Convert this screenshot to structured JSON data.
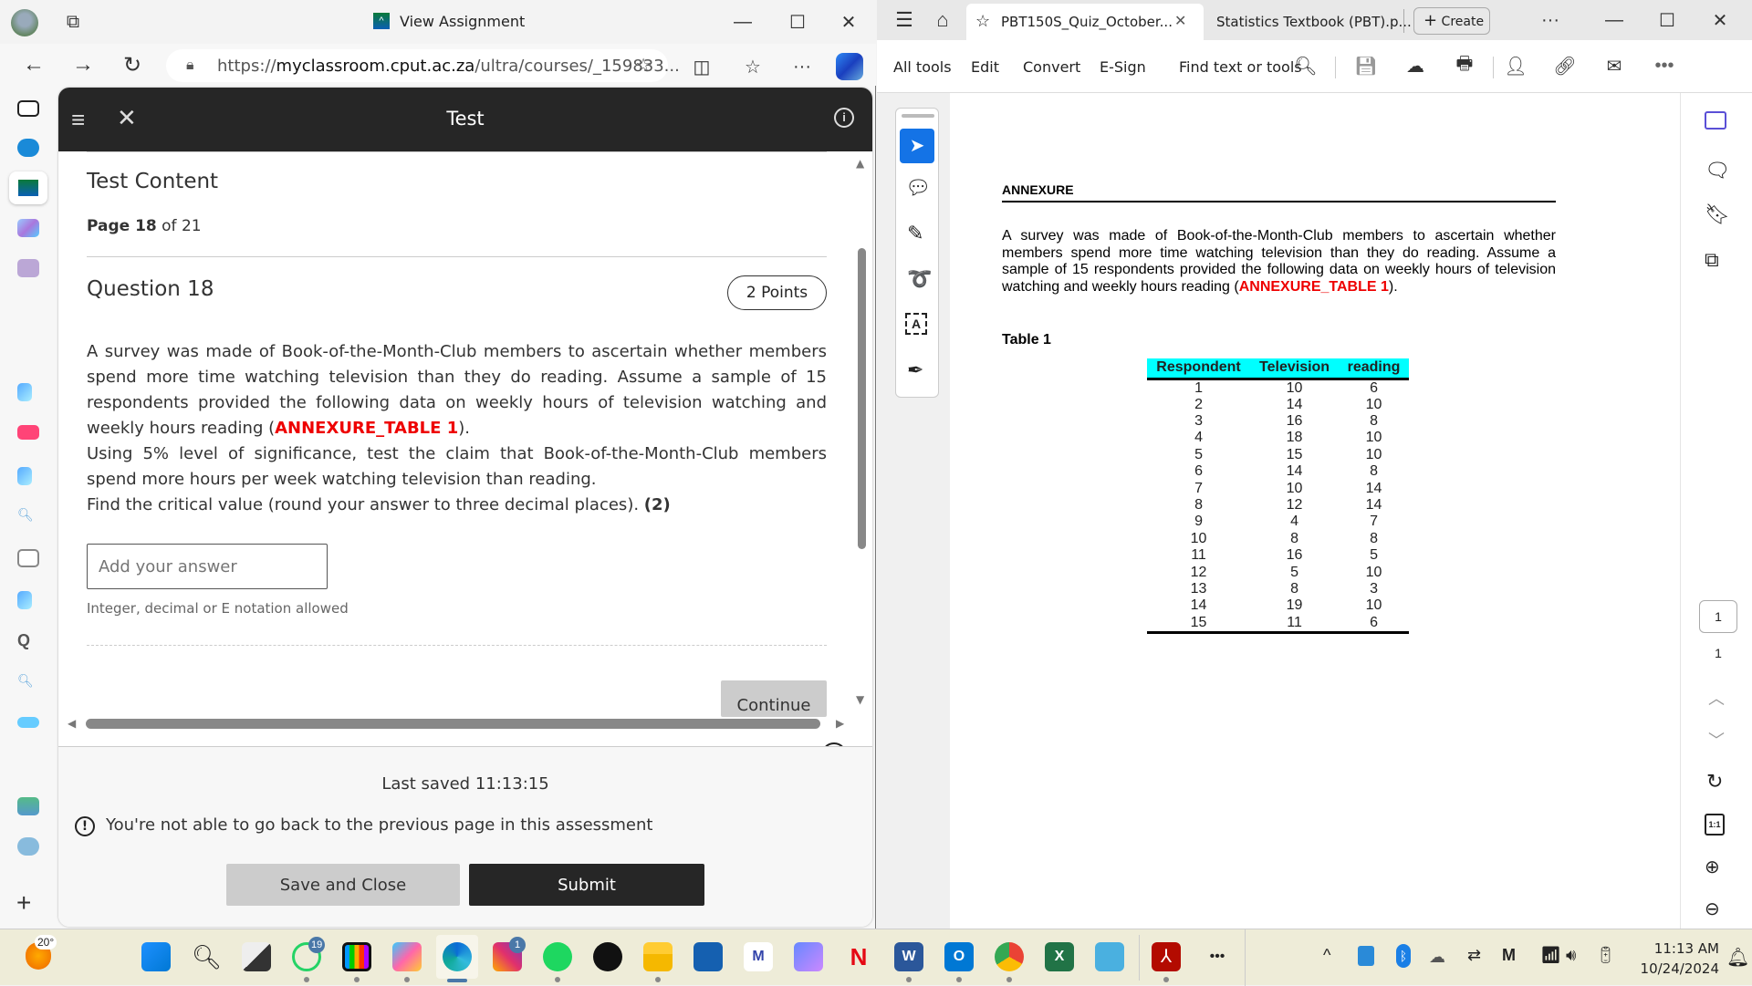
{
  "left_window": {
    "title": "View Assignment",
    "url_prefix": "https://",
    "url_host": "myclassroom.cput.ac.za",
    "url_path": "/ultra/courses/_159833...",
    "test": {
      "header_title": "Test",
      "section_title": "Test Content",
      "page_label": "Page 18",
      "page_of": "of 21",
      "question_title": "Question 18",
      "points_badge": "2 Points",
      "question_text_1": "A survey was made of Book-of-the-Month-Club members to ascertain whether members spend more time watching television than they do reading. Assume a sample of 15 respondents provided the following data on weekly hours of television watching and weekly hours reading (",
      "question_ref": "ANNEXURE_TABLE 1",
      "question_text_1_end": ").",
      "question_text_2": "Using 5% level of significance, test the claim that Book-of-the-Month-Club members spend more hours per week watching television than reading.",
      "question_text_3": "Find the critical value (round your answer to three decimal places). ",
      "question_marks": "(2)",
      "answer_placeholder": "Add your answer",
      "answer_value": "",
      "answer_hint": "Integer, decimal or E notation allowed",
      "continue_label": "Continue",
      "last_saved": "Last saved 11:13:15",
      "warning_text": "You're not able to go back to the previous page in this assessment",
      "save_close_label": "Save and Close",
      "submit_label": "Submit"
    }
  },
  "right_window": {
    "tabs": [
      {
        "label": "PBT150S_Quiz_October...",
        "active": true
      },
      {
        "label": "Statistics Textbook (PBT).p...",
        "active": false
      }
    ],
    "create_label": "Create",
    "toolbar": {
      "all_tools": "All tools",
      "edit": "Edit",
      "convert": "Convert",
      "esign": "E-Sign",
      "find": "Find text or tools"
    },
    "page_input": "1",
    "page_total": "1",
    "pdf": {
      "heading": "ANNEXURE",
      "paragraph": "A survey was made of Book-of-the-Month-Club members to ascertain whether members spend more time watching television than they do reading. Assume a sample of 15 respondents provided the following data on weekly hours of television watching and weekly hours reading (",
      "paragraph_ref": "ANNEXURE_TABLE 1",
      "paragraph_end": ").",
      "table_caption": "Table 1",
      "table_headers": [
        "Respondent",
        "Television",
        "reading"
      ],
      "table_rows": [
        [
          "1",
          "10",
          "6"
        ],
        [
          "2",
          "14",
          "10"
        ],
        [
          "3",
          "16",
          "8"
        ],
        [
          "4",
          "18",
          "10"
        ],
        [
          "5",
          "15",
          "10"
        ],
        [
          "6",
          "14",
          "8"
        ],
        [
          "7",
          "10",
          "14"
        ],
        [
          "8",
          "12",
          "14"
        ],
        [
          "9",
          "4",
          "7"
        ],
        [
          "10",
          "8",
          "8"
        ],
        [
          "11",
          "16",
          "5"
        ],
        [
          "12",
          "5",
          "10"
        ],
        [
          "13",
          "8",
          "3"
        ],
        [
          "14",
          "19",
          "10"
        ],
        [
          "15",
          "11",
          "6"
        ]
      ]
    }
  },
  "taskbar": {
    "weather_temp": "20°",
    "whatsapp_badge": "19",
    "instagram_badge": "1",
    "time": "11:13 AM",
    "date": "10/24/2024"
  },
  "colors": {
    "accent_red": "#e00000",
    "acrobat_blue": "#1473e6",
    "table_header": "#00ffff",
    "submit_bg": "#262626"
  }
}
